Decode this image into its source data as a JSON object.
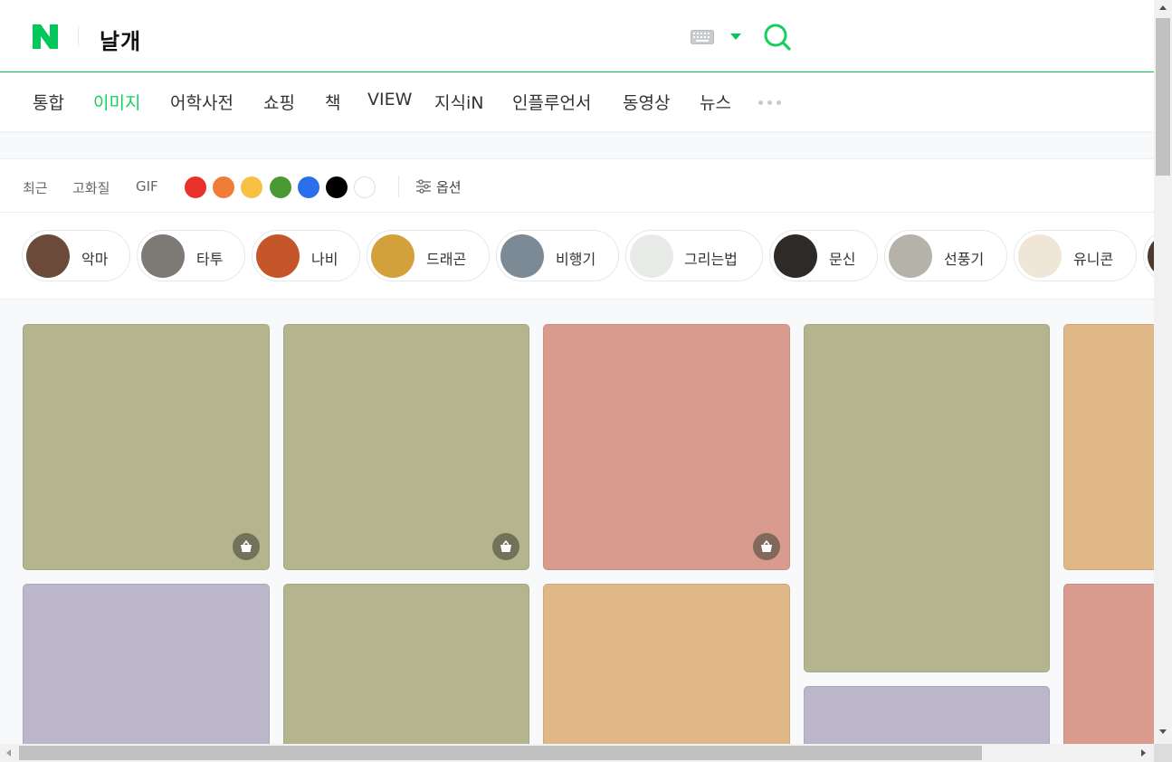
{
  "header": {
    "query": "날개",
    "logo_icon": "naver-n-logo",
    "keyboard_icon": "keyboard-icon",
    "search_icon": "search-icon",
    "brand_color": "#03c75a"
  },
  "tabs": [
    {
      "label": "통합"
    },
    {
      "label": "이미지",
      "active": true
    },
    {
      "label": "어학사전"
    },
    {
      "label": "쇼핑"
    },
    {
      "label": "책"
    },
    {
      "label": "VIEW"
    },
    {
      "label": "지식iN"
    },
    {
      "label": "인플루언서"
    },
    {
      "label": "동영상"
    },
    {
      "label": "뉴스"
    }
  ],
  "filters": {
    "recent": "최근",
    "hires": "고화질",
    "gif": "GIF",
    "colors": [
      "#e8312a",
      "#f07c38",
      "#f7c042",
      "#4a9a34",
      "#2c6fed",
      "#000000",
      "#ffffff"
    ],
    "options_label": "옵션"
  },
  "related": [
    {
      "label": "악마",
      "thumb": "#6b4a3a"
    },
    {
      "label": "타투",
      "thumb": "#7d7a76"
    },
    {
      "label": "나비",
      "thumb": "#c4562a"
    },
    {
      "label": "드래곤",
      "thumb": "#d4a03b"
    },
    {
      "label": "비행기",
      "thumb": "#7c8a96"
    },
    {
      "label": "그리는법",
      "thumb": "#e8eae8"
    },
    {
      "label": "문신",
      "thumb": "#2e2a28"
    },
    {
      "label": "선풍기",
      "thumb": "#b5b2aa"
    },
    {
      "label": "유니콘",
      "thumb": "#f0e6d8"
    }
  ],
  "tile_colors": {
    "olive": "#b4b48e",
    "rose": "#d89b8e",
    "sand": "#e0b787",
    "lavender": "#bcb6cb"
  }
}
